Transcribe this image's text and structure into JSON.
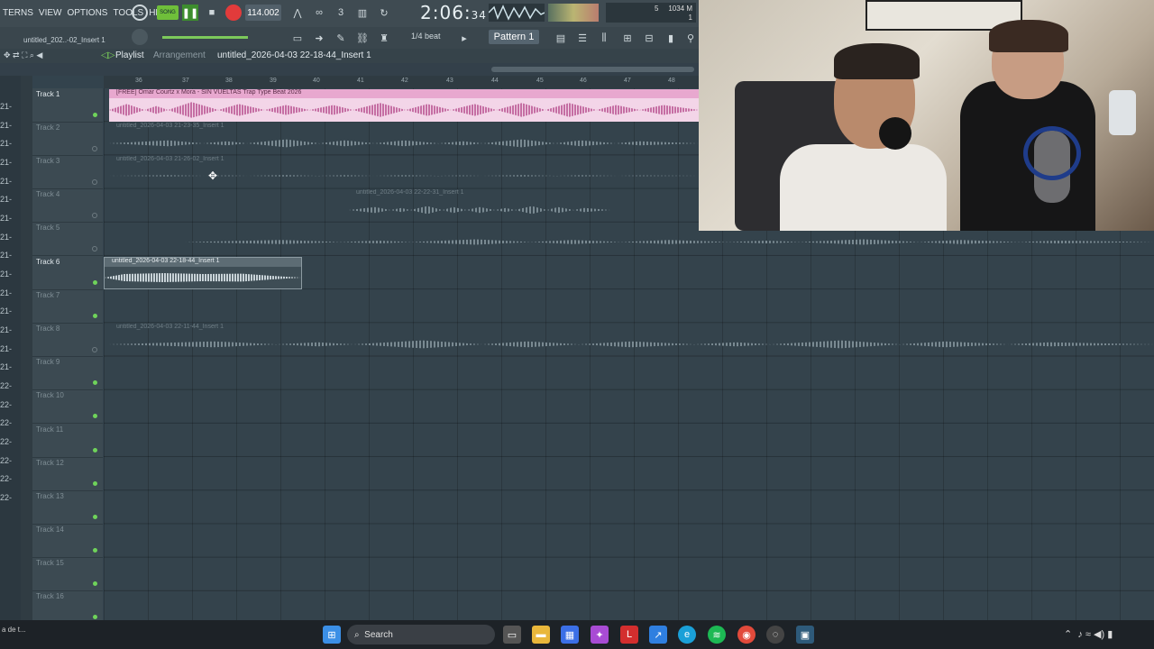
{
  "menu": [
    "TERNS",
    "VIEW",
    "OPTIONS",
    "TOOLS",
    "HELP"
  ],
  "transport": {
    "mode": "SONG",
    "tempo": "114.002",
    "time_main": "2:06",
    "time_sub": "34",
    "cpu": "1034 M",
    "voices": "5",
    "poly": "1"
  },
  "toolbar": {
    "snap": "1/4 beat",
    "pattern": "Pattern 1",
    "browser_item": "untitled_202..-02_Insert 1"
  },
  "playlist": {
    "title": "Playlist",
    "subtitle": "Arrangement",
    "path": "untitled_2026-04-03 22-18-44_Insert 1"
  },
  "ruler_marks": [
    "36",
    "37",
    "38",
    "39",
    "40",
    "41",
    "42",
    "43",
    "44",
    "45",
    "46",
    "47",
    "48"
  ],
  "left_items": [
    "21-",
    "21-",
    "21-",
    "21-",
    "21-",
    "21-",
    "21-",
    "21-",
    "21-",
    "21-",
    "21-",
    "21-",
    "21-",
    "21-",
    "21-",
    "22-",
    "22-",
    "22-",
    "22-",
    "22-",
    "22-",
    "22-"
  ],
  "tracks": [
    {
      "name": "Track 1",
      "active": true,
      "led": true
    },
    {
      "name": "Track 2",
      "active": false,
      "led": false
    },
    {
      "name": "Track 3",
      "active": false,
      "led": false
    },
    {
      "name": "Track 4",
      "active": false,
      "led": false
    },
    {
      "name": "Track 5",
      "active": false,
      "led": false
    },
    {
      "name": "Track 6",
      "active": true,
      "led": true
    },
    {
      "name": "Track 7",
      "active": false,
      "led": true
    },
    {
      "name": "Track 8",
      "active": false,
      "led": false
    },
    {
      "name": "Track 9",
      "active": false,
      "led": true
    },
    {
      "name": "Track 10",
      "active": false,
      "led": true
    },
    {
      "name": "Track 11",
      "active": false,
      "led": true
    },
    {
      "name": "Track 12",
      "active": false,
      "led": true
    },
    {
      "name": "Track 13",
      "active": false,
      "led": true
    },
    {
      "name": "Track 14",
      "active": false,
      "led": true
    },
    {
      "name": "Track 15",
      "active": false,
      "led": true
    },
    {
      "name": "Track 16",
      "active": false,
      "led": true
    }
  ],
  "clips": {
    "c1": "[FREE] Omar Courtz x Mora - SIN VUELTAS Trap Type Beat 2026",
    "c2": "untitled_2026-04-03 21-23-35_Insert 1",
    "c3": "untitled_2026-04-03 21-26-02_Insert 1",
    "c4": "untitled_2026-04-03 22-22-31_Insert 1",
    "c6": "untitled_2026-04-03 22-18-44_Insert 1",
    "c8": "untitled_2026-04-03 22-11-44_Insert 1"
  },
  "taskbar": {
    "search": "Search",
    "status_left": "a de t..."
  }
}
